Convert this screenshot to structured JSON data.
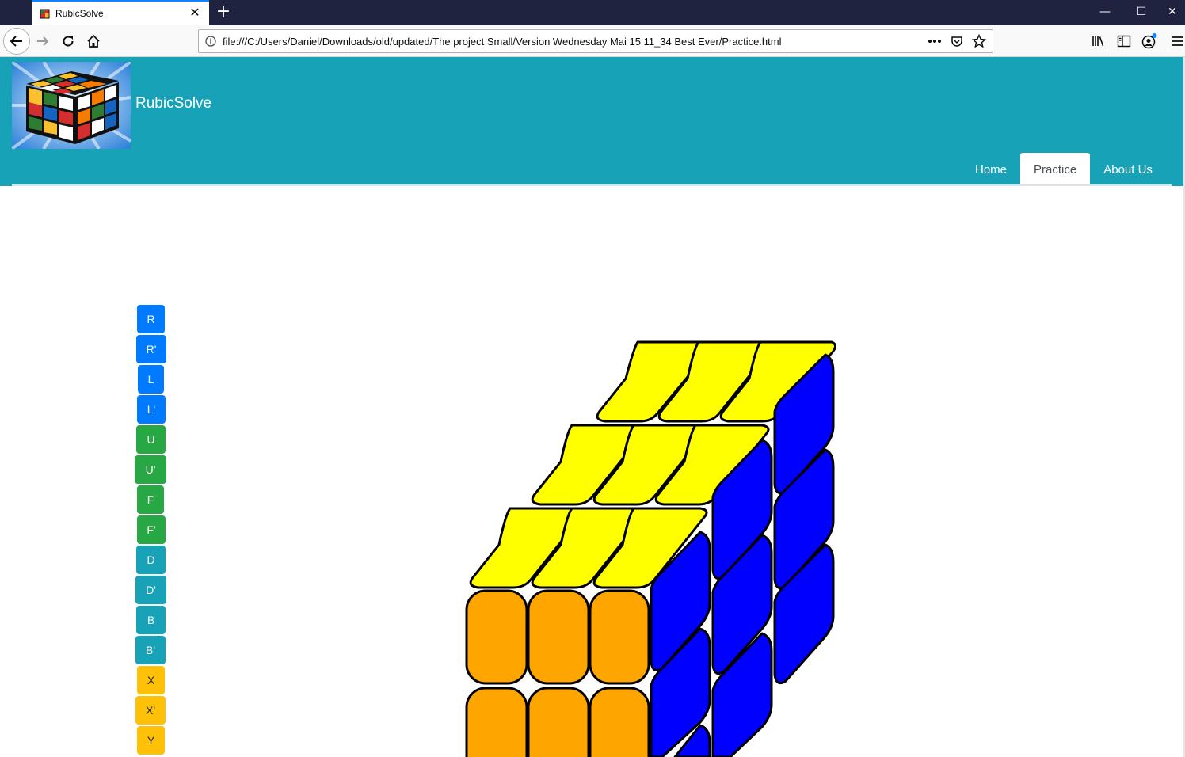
{
  "browser": {
    "tab_title": "RubicSolve",
    "url": "file:///C:/Users/Daniel/Downloads/old/updated/The project Small/Version Wednesday Mai 15 11_34 Best Ever/Practice.html",
    "icons": [
      "back-icon",
      "forward-icon",
      "reload-icon",
      "home-icon",
      "info-icon",
      "more-icon",
      "pocket-icon",
      "bookmark-star-icon",
      "library-icon",
      "sidebar-icon",
      "account-icon",
      "menu-icon"
    ]
  },
  "site": {
    "brand": "RubicSolve",
    "nav": [
      "Home",
      "Practice",
      "About Us"
    ],
    "active_nav": "Practice"
  },
  "moves": [
    {
      "label": "R",
      "color": "#007bff"
    },
    {
      "label": "R'",
      "color": "#007bff"
    },
    {
      "label": "L",
      "color": "#007bff"
    },
    {
      "label": "L'",
      "color": "#007bff"
    },
    {
      "label": "U",
      "color": "#28a745"
    },
    {
      "label": "U'",
      "color": "#28a745"
    },
    {
      "label": "F",
      "color": "#28a745"
    },
    {
      "label": "F'",
      "color": "#28a745"
    },
    {
      "label": "D",
      "color": "#17a2b8"
    },
    {
      "label": "D'",
      "color": "#17a2b8"
    },
    {
      "label": "B",
      "color": "#17a2b8"
    },
    {
      "label": "B'",
      "color": "#17a2b8"
    },
    {
      "label": "X",
      "color": "#ffc107"
    },
    {
      "label": "X'",
      "color": "#ffc107"
    },
    {
      "label": "Y",
      "color": "#ffc107"
    }
  ],
  "cube": {
    "top_color": "#ffff00",
    "front_color": "#ffa500",
    "side_color": "#0000ff",
    "top": [
      "yellow",
      "yellow",
      "yellow",
      "yellow",
      "yellow",
      "yellow",
      "yellow",
      "yellow",
      "yellow"
    ],
    "front": [
      "orange",
      "orange",
      "orange",
      "orange",
      "orange",
      "orange"
    ],
    "right": [
      "blue",
      "blue",
      "blue",
      "blue",
      "blue",
      "blue",
      "blue",
      "blue"
    ]
  }
}
